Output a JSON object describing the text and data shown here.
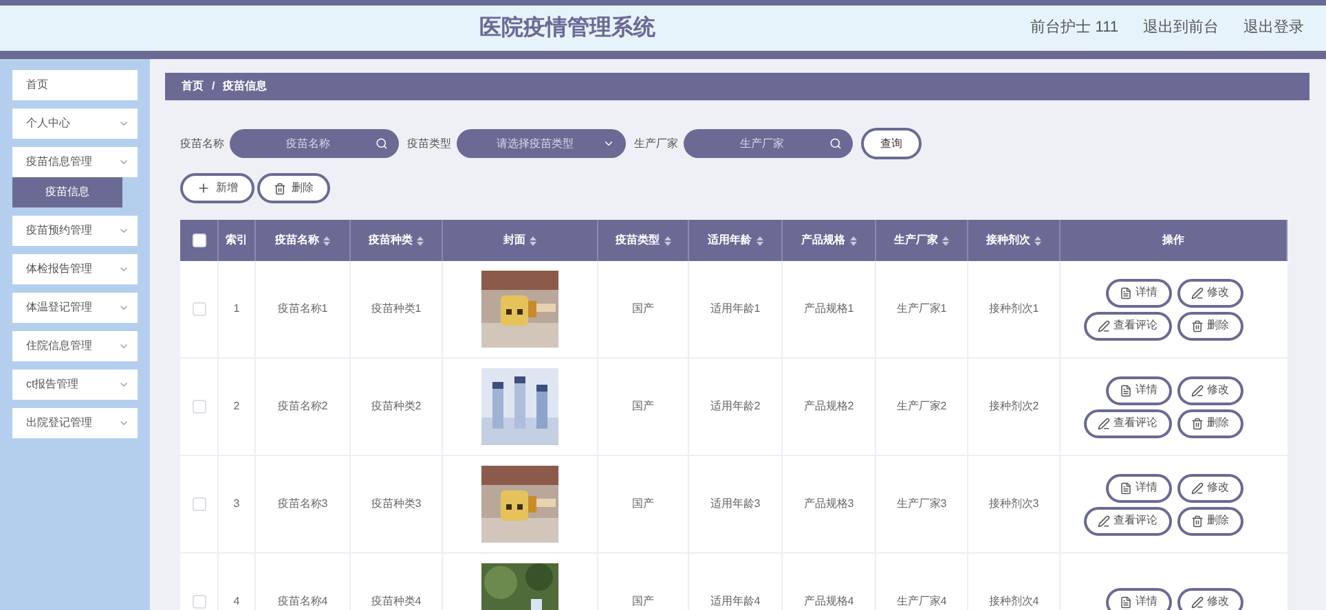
{
  "header": {
    "title": "医院疫情管理系统",
    "links": [
      "前台护士 111",
      "退出到前台",
      "退出登录"
    ]
  },
  "sidebar": {
    "items": [
      {
        "label": "首页",
        "expandable": false
      },
      {
        "label": "个人中心",
        "expandable": true
      },
      {
        "label": "疫苗信息管理",
        "expandable": true,
        "children": [
          {
            "label": "疫苗信息",
            "selected": true
          }
        ]
      },
      {
        "label": "疫苗预约管理",
        "expandable": true
      },
      {
        "label": "体检报告管理",
        "expandable": true
      },
      {
        "label": "体温登记管理",
        "expandable": true
      },
      {
        "label": "住院信息管理",
        "expandable": true
      },
      {
        "label": "ct报告管理",
        "expandable": true
      },
      {
        "label": "出院登记管理",
        "expandable": true
      }
    ]
  },
  "breadcrumb": [
    "首页",
    "/",
    "疫苗信息"
  ],
  "search": {
    "fields": [
      {
        "label": "疫苗名称",
        "placeholder": "疫苗名称",
        "kind": "search"
      },
      {
        "label": "疫苗类型",
        "placeholder": "请选择疫苗类型",
        "kind": "select"
      },
      {
        "label": "生产厂家",
        "placeholder": "生产厂家",
        "kind": "search"
      }
    ],
    "button": "查询"
  },
  "actions": [
    {
      "label": "新增",
      "kind": "add"
    },
    {
      "label": "删除",
      "kind": "delete"
    }
  ],
  "table": {
    "columns": [
      {
        "label": "索引",
        "sortable": false
      },
      {
        "label": "疫苗名称",
        "sortable": true
      },
      {
        "label": "疫苗种类",
        "sortable": true
      },
      {
        "label": "封面",
        "sortable": true
      },
      {
        "label": "疫苗类型",
        "sortable": true
      },
      {
        "label": "适用年龄",
        "sortable": true
      },
      {
        "label": "产品规格",
        "sortable": true
      },
      {
        "label": "生产厂家",
        "sortable": true
      },
      {
        "label": "接种剂次",
        "sortable": true
      },
      {
        "label": "操作",
        "sortable": false
      }
    ],
    "header_checked": false,
    "rows": [
      {
        "checked": false,
        "cells": [
          "1",
          "疫苗名称1",
          "疫苗种类1",
          {
            "kind": "picture"
          },
          "国产",
          "适用年龄1",
          "产品规格1",
          "生产厂家1",
          "接种剂次1"
        ],
        "buttons": [
          {
            "label": "详情",
            "kind": "detail"
          },
          {
            "label": "修改",
            "kind": "edit"
          },
          {
            "label": "查看评论",
            "kind": "edit"
          },
          {
            "label": "删除",
            "kind": "delete"
          }
        ]
      },
      {
        "checked": false,
        "cells": [
          "2",
          "疫苗名称2",
          "疫苗种类2",
          {
            "kind": "picture"
          },
          "国产",
          "适用年龄2",
          "产品规格2",
          "生产厂家2",
          "接种剂次2"
        ],
        "buttons": [
          {
            "label": "详情",
            "kind": "detail"
          },
          {
            "label": "修改",
            "kind": "edit"
          },
          {
            "label": "查看评论",
            "kind": "edit"
          },
          {
            "label": "删除",
            "kind": "delete"
          }
        ]
      },
      {
        "checked": false,
        "cells": [
          "3",
          "疫苗名称3",
          "疫苗种类3",
          {
            "kind": "picture"
          },
          "国产",
          "适用年龄3",
          "产品规格3",
          "生产厂家3",
          "接种剂次3"
        ],
        "buttons": [
          {
            "label": "详情",
            "kind": "detail"
          },
          {
            "label": "修改",
            "kind": "edit"
          },
          {
            "label": "查看评论",
            "kind": "edit"
          },
          {
            "label": "删除",
            "kind": "delete"
          }
        ]
      },
      {
        "checked": false,
        "cells": [
          "4",
          "疫苗名称4",
          "疫苗种类4",
          {
            "kind": "picture"
          },
          "国产",
          "适用年龄4",
          "产品规格4",
          "生产厂家4",
          "接种剂次4"
        ],
        "buttons": [
          {
            "label": "详情",
            "kind": "detail"
          },
          {
            "label": "修改",
            "kind": "edit"
          }
        ]
      }
    ]
  }
}
